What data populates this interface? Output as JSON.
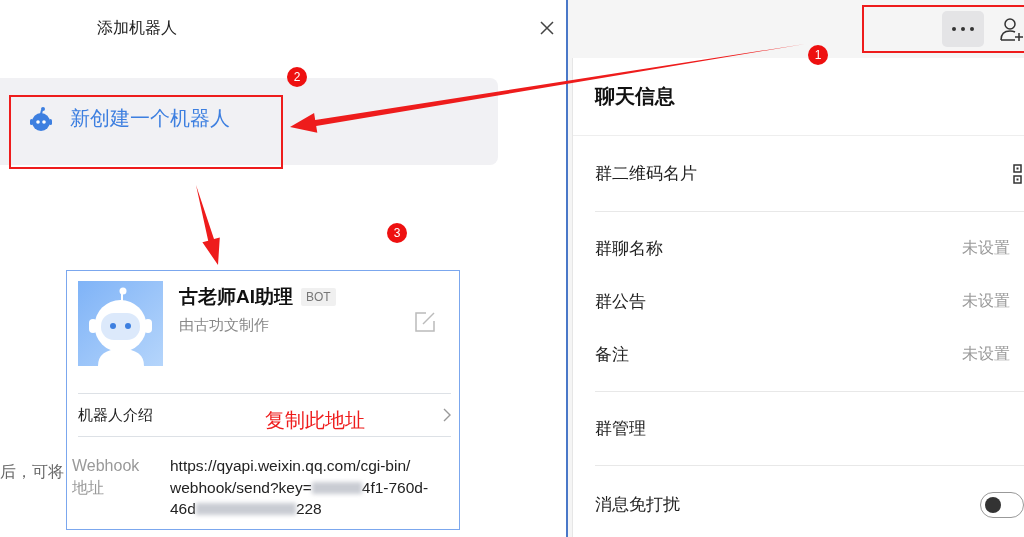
{
  "dialog": {
    "title": "添加机器人",
    "create_option": "新创建一个机器人",
    "hint_fragment": "后，可将"
  },
  "bot_card": {
    "name": "古老师AI助理",
    "badge": "BOT",
    "creator": "由古功文制作",
    "intro_label": "机器人介绍",
    "webhook_label": "Webhook 地址",
    "webhook_url_lines": [
      [
        {
          "kind": "text",
          "text": "https://qyapi.weixin.qq.com/cgi-bin/"
        }
      ],
      [
        {
          "kind": "text",
          "text": "webhook/send?key="
        },
        {
          "kind": "redacted"
        },
        {
          "kind": "text",
          "text": "4f1-760d-"
        }
      ],
      [
        {
          "kind": "text",
          "text": "46d"
        },
        {
          "kind": "redacted"
        },
        {
          "kind": "text",
          "text": "228"
        }
      ]
    ]
  },
  "chat_info": {
    "title": "聊天信息",
    "sections": [
      [
        {
          "kind": "qr",
          "label": "群二维码名片"
        }
      ],
      [
        {
          "kind": "value",
          "label": "群聊名称",
          "value": "未设置"
        },
        {
          "kind": "value",
          "label": "群公告",
          "value": "未设置"
        },
        {
          "kind": "value",
          "label": "备注",
          "value": "未设置"
        }
      ],
      [
        {
          "kind": "plain",
          "label": "群管理"
        }
      ],
      [
        {
          "kind": "toggle",
          "label": "消息免打扰",
          "on": false
        }
      ]
    ]
  },
  "annotations": {
    "steps": [
      "1",
      "2",
      "3"
    ],
    "note": "复制此地址"
  }
}
